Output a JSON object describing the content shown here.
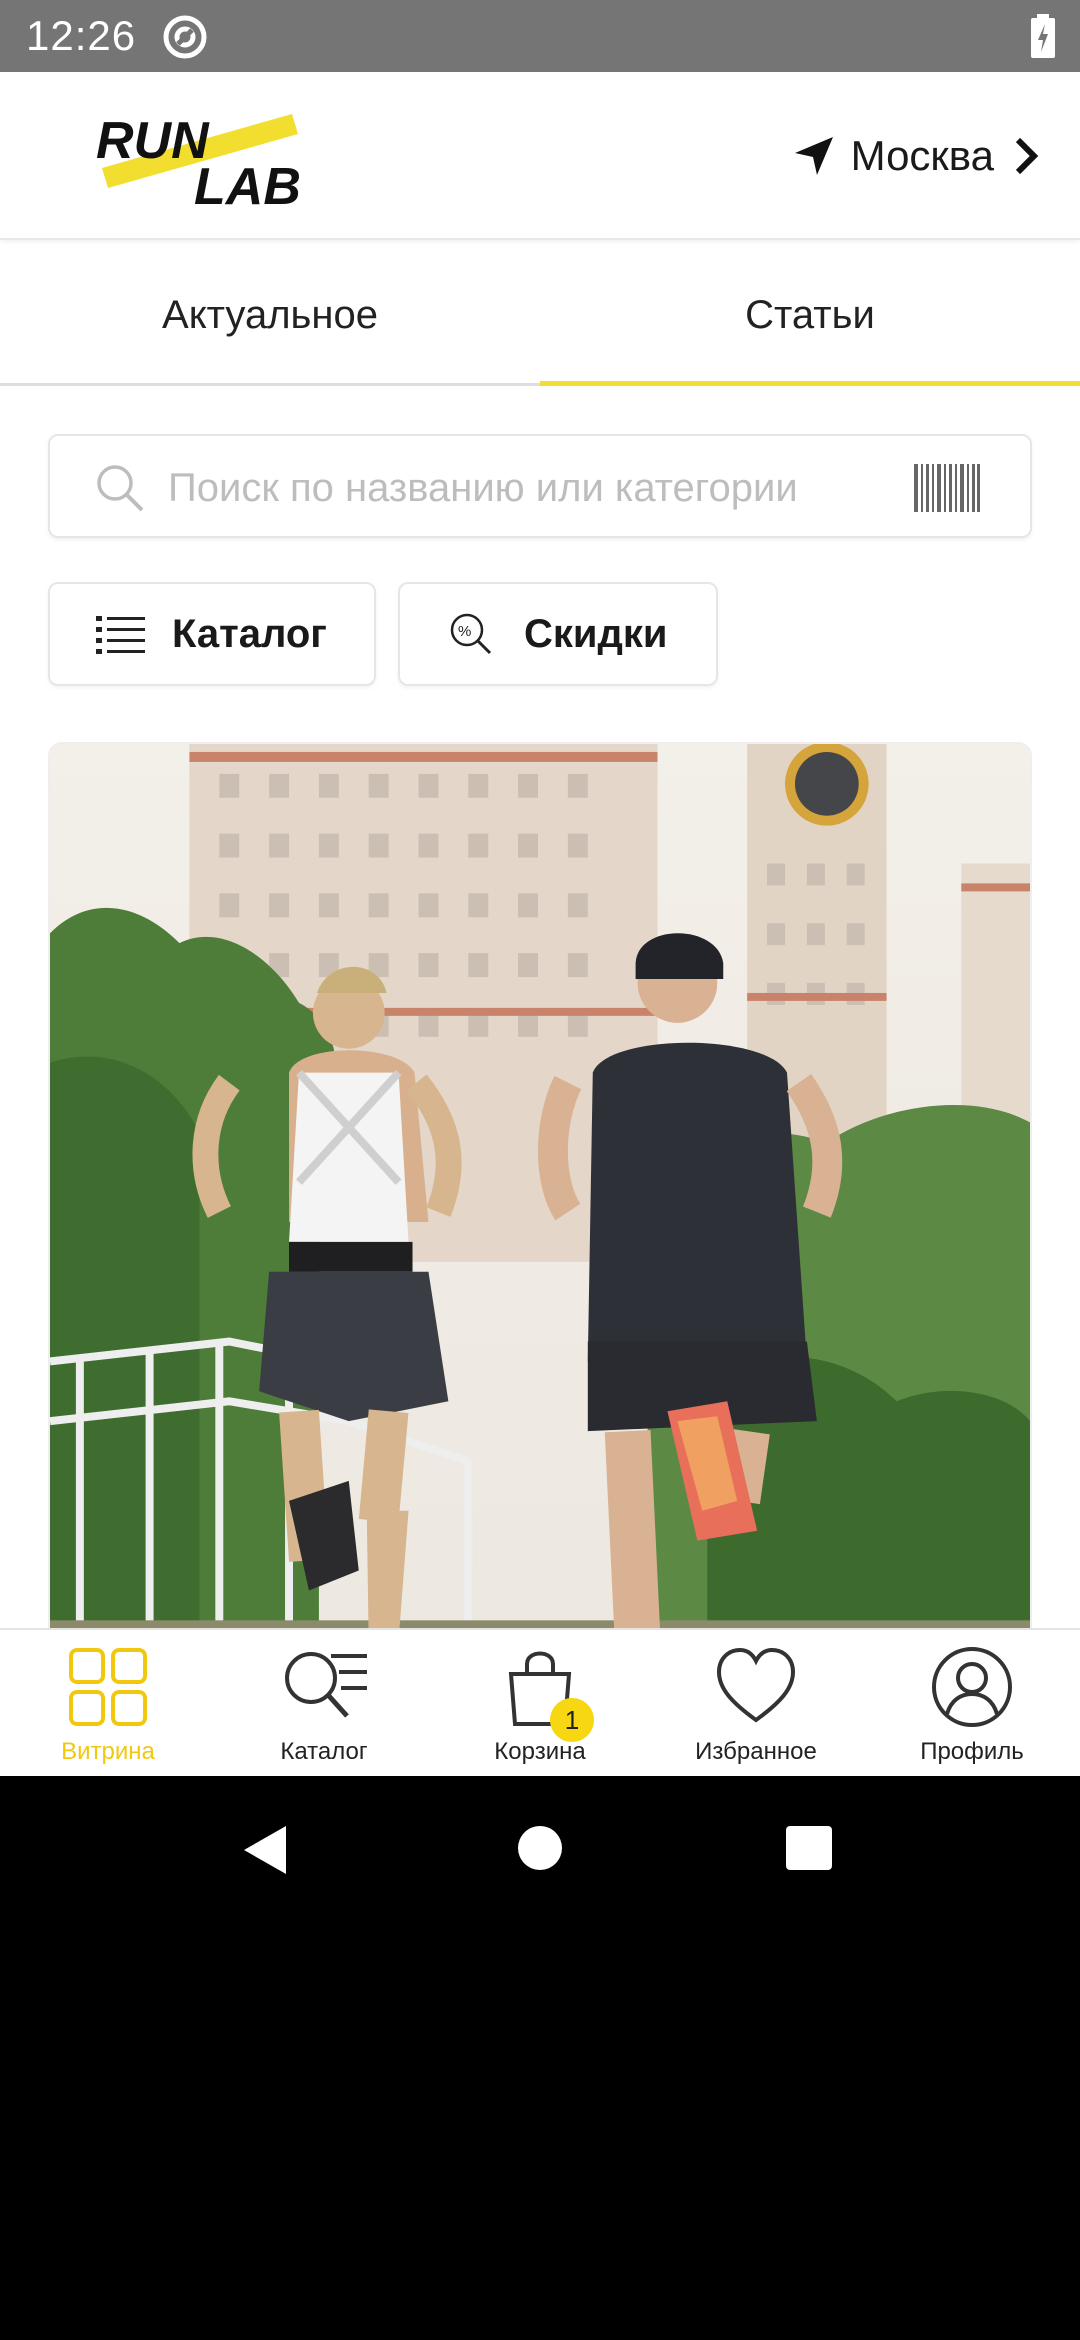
{
  "status_bar": {
    "time": "12:26"
  },
  "header": {
    "logo_text_top": "RUN",
    "logo_text_bottom": "LAB",
    "city": "Москва"
  },
  "tabs": [
    {
      "label": "Актуальное",
      "active": false
    },
    {
      "label": "Статьи",
      "active": true
    }
  ],
  "search": {
    "placeholder": "Поиск по названию или категории",
    "value": ""
  },
  "chips": [
    {
      "label": "Каталог",
      "icon": "list-icon"
    },
    {
      "label": "Скидки",
      "icon": "discount-search-icon"
    }
  ],
  "article": {
    "image": "runners-photo"
  },
  "bottom_nav": {
    "items": [
      {
        "label": "Витрина",
        "icon": "grid-icon",
        "active": true
      },
      {
        "label": "Каталог",
        "icon": "catalog-search-icon",
        "active": false
      },
      {
        "label": "Корзина",
        "icon": "bag-icon",
        "active": false,
        "badge": "1"
      },
      {
        "label": "Избранное",
        "icon": "heart-icon",
        "active": false
      },
      {
        "label": "Профиль",
        "icon": "profile-icon",
        "active": false
      }
    ]
  },
  "colors": {
    "accent": "#f2de2f",
    "active_nav": "#f2c80f",
    "status_bar": "#757575"
  }
}
